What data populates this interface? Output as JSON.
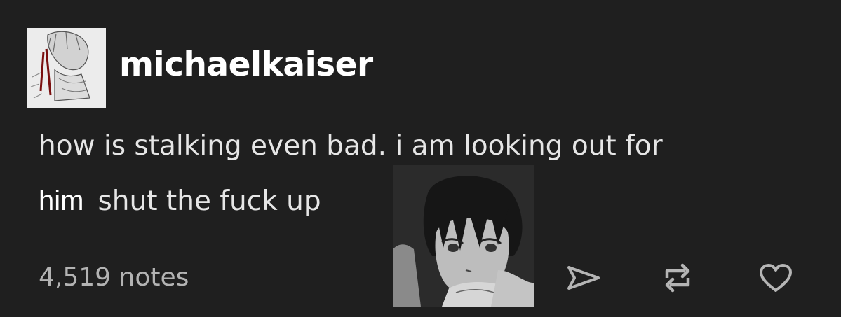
{
  "post": {
    "username": "michaelkaiser",
    "body_line1": "how is stalking even bad. i am looking out for",
    "body_line2_word": "him",
    "body_line2_rest": "shut the fuck up",
    "notes": "4,519 notes"
  },
  "icons": {
    "avatar": "avatar",
    "reply_image": "manga-character-image",
    "share": "share-icon",
    "reblog": "reblog-icon",
    "like": "heart-icon"
  },
  "colors": {
    "background": "#1f1f1f",
    "text": "#e6e6e6",
    "muted": "#b3b3b3"
  }
}
